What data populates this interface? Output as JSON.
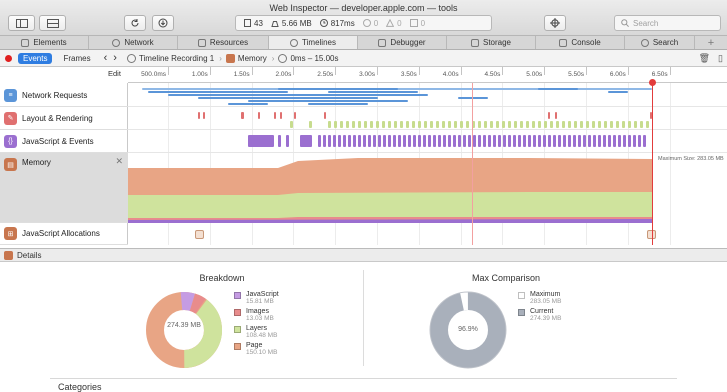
{
  "window": {
    "title": "Web Inspector — developer.apple.com — tools"
  },
  "stats": {
    "resources": "43",
    "size": "5.66 MB",
    "time": "817ms",
    "errors": "0",
    "warnings": "0",
    "logs": "0"
  },
  "search": {
    "placeholder": "Search"
  },
  "tabs": [
    {
      "label": "Elements"
    },
    {
      "label": "Network"
    },
    {
      "label": "Resources"
    },
    {
      "label": "Timelines"
    },
    {
      "label": "Debugger"
    },
    {
      "label": "Storage"
    },
    {
      "label": "Console"
    },
    {
      "label": "Search"
    }
  ],
  "nav": {
    "events": "Events",
    "frames": "Frames",
    "crumb_recording": "Timeline Recording 1",
    "crumb_memory": "Memory",
    "crumb_range": "0ms – 15.00s",
    "edit": "Edit"
  },
  "ruler": {
    "ticks": [
      "500.0ms",
      "1.00s",
      "1.50s",
      "2.00s",
      "2.50s",
      "3.00s",
      "3.50s",
      "4.00s",
      "4.50s",
      "5.00s",
      "5.50s",
      "6.00s",
      "6.50s"
    ]
  },
  "timelines": [
    {
      "label": "Network Requests",
      "color": "#5b95d8"
    },
    {
      "label": "Layout & Rendering",
      "color": "#e07070"
    },
    {
      "label": "JavaScript & Events",
      "color": "#9b6fd0"
    },
    {
      "label": "Memory",
      "color": "#c8764e"
    },
    {
      "label": "JavaScript Allocations",
      "color": "#c8764e"
    }
  ],
  "memory": {
    "max_size": "Maximum Size: 283.05 MB"
  },
  "details": {
    "label": "Details"
  },
  "breakdown": {
    "title": "Breakdown",
    "center": "274.39 MB",
    "items": [
      {
        "label": "JavaScript",
        "value": "15.81 MB",
        "color": "#c59ce3"
      },
      {
        "label": "Images",
        "value": "13.03 MB",
        "color": "#e88c8c"
      },
      {
        "label": "Layers",
        "value": "108.48 MB",
        "color": "#cfe39d"
      },
      {
        "label": "Page",
        "value": "150.10 MB",
        "color": "#e8a585"
      }
    ]
  },
  "max_comparison": {
    "title": "Max Comparison",
    "center": "96.9%",
    "items": [
      {
        "label": "Maximum",
        "value": "283.05 MB",
        "color": "#ffffff"
      },
      {
        "label": "Current",
        "value": "274.39 MB",
        "color": "#a9b0bb"
      }
    ]
  },
  "categories": {
    "label": "Categories"
  }
}
